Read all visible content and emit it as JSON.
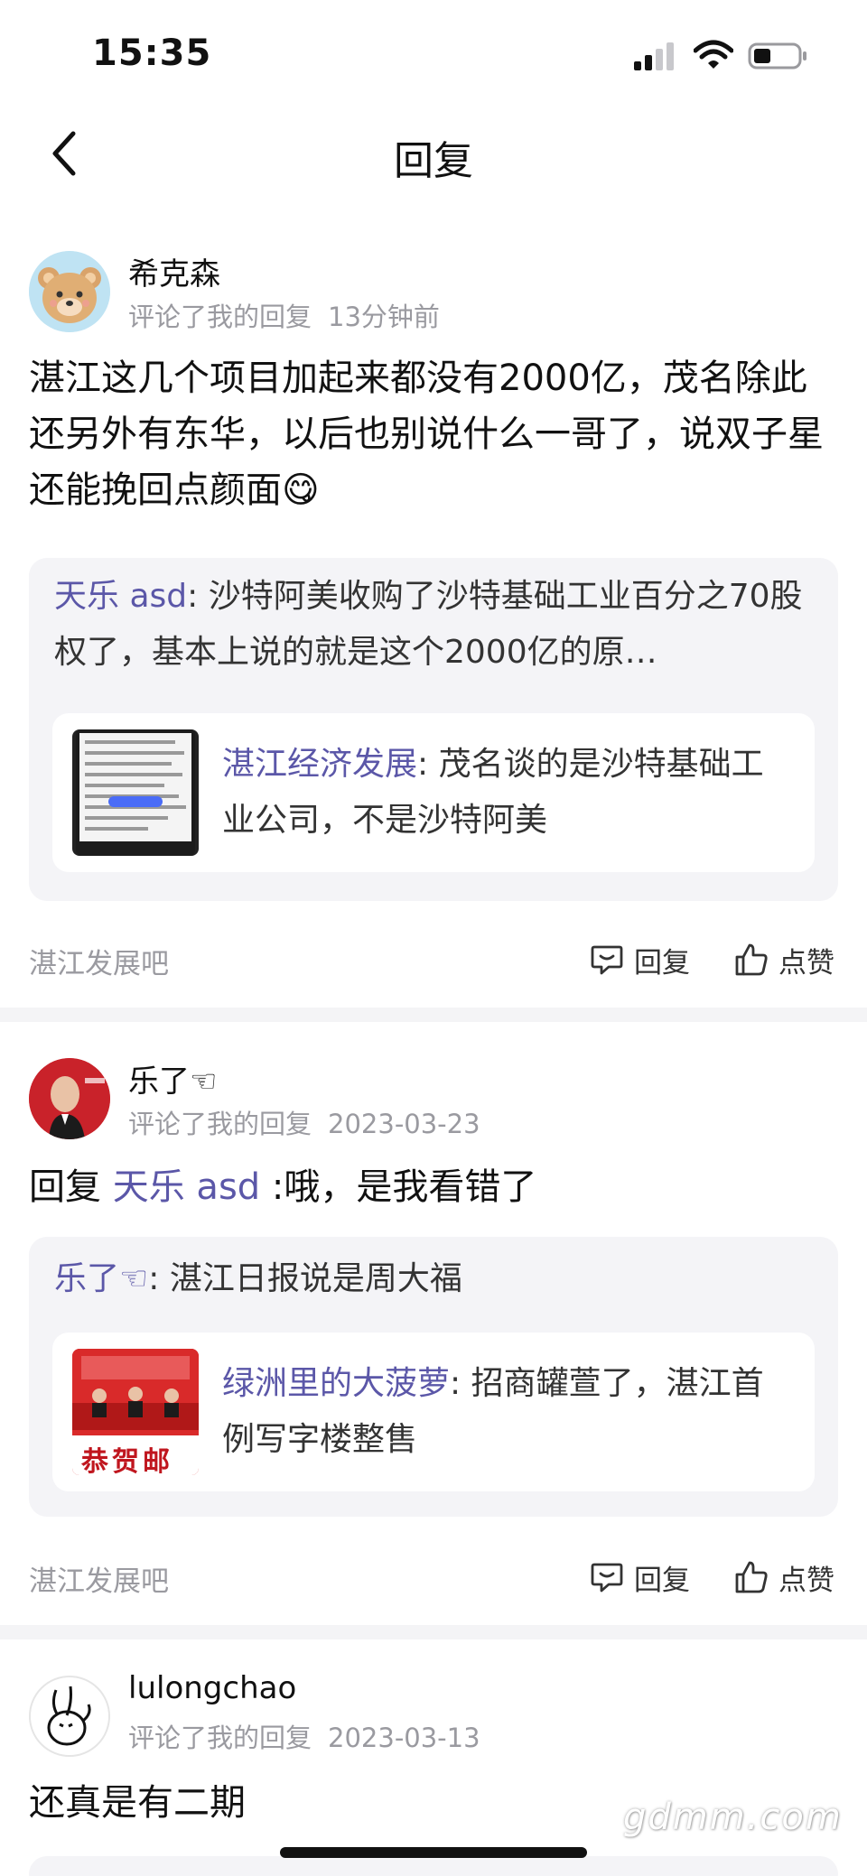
{
  "status_bar": {
    "time": "15:35"
  },
  "nav": {
    "title": "回复"
  },
  "comments": [
    {
      "username": "希克森",
      "action": "评论了我的回复",
      "time": "13分钟前",
      "text": "湛江这几个项目加起来都没有2000亿，茂名除此还另外有东华，以后也别说什么一哥了，说双子星还能挽回点颜面😋",
      "quote_name": "天乐 asd",
      "quote_text": ": 沙特阿美收购了沙特基础工业百分之70股权了，基本上说的就是这个2000亿的原…",
      "nested_name": "湛江经济发展",
      "nested_text": ": 茂名谈的是沙特基础工业公司，不是沙特阿美",
      "forum": "湛江发展吧",
      "reply_label": "回复",
      "like_label": "点赞"
    },
    {
      "username": "乐了☜",
      "action": "评论了我的回复",
      "time": "2023-03-23",
      "text_prefix": "回复 ",
      "mention": "天乐 asd",
      "text_suffix": " :哦，是我看错了",
      "quote_name": "乐了☜",
      "quote_text": ": 湛江日报说是周大福",
      "nested_name": "绿洲里的大菠萝",
      "nested_text": ": 招商罐萱了，湛江首例写字楼整售",
      "nested_thumb_text": "恭贺邮",
      "forum": "湛江发展吧",
      "reply_label": "回复",
      "like_label": "点赞"
    },
    {
      "username": "lulongchao",
      "action": "评论了我的回复",
      "time": "2023-03-13",
      "text": "还真是有二期"
    }
  ],
  "watermark": "gdmm.com",
  "colors": {
    "mention": "#5b57a8",
    "meta": "#9a9aa0",
    "quote_bg": "#f4f4f7"
  }
}
